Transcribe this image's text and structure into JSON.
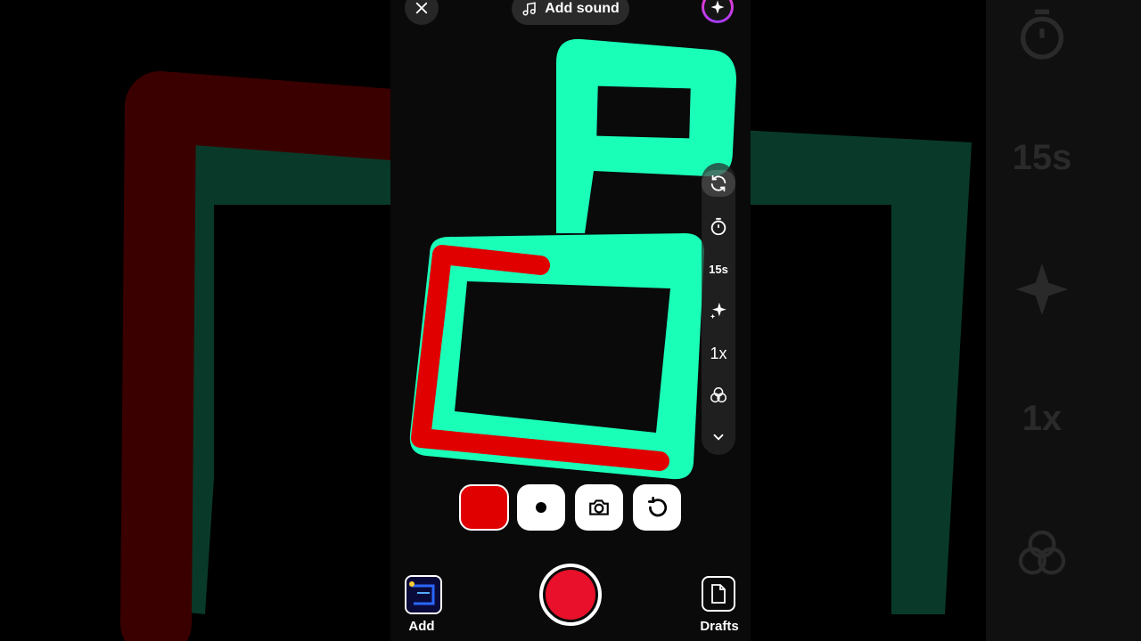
{
  "header": {
    "add_sound_label": "Add sound"
  },
  "side_rail": {
    "duration_label": "15s",
    "speed_label": "1x",
    "items": [
      "flip-camera-icon",
      "timer-icon",
      "duration",
      "effects-sparkle-icon",
      "speed",
      "filters-icon",
      "chevron-down-icon"
    ]
  },
  "tools": [
    "color-swatch",
    "brush-size-icon",
    "camera-icon",
    "undo-icon"
  ],
  "bottom": {
    "add_label": "Add",
    "drafts_label": "Drafts"
  },
  "colors": {
    "teal_stroke": "#1AFFB8",
    "red_stroke": "#E00000",
    "record": "#E8102A",
    "background": "#000000"
  }
}
